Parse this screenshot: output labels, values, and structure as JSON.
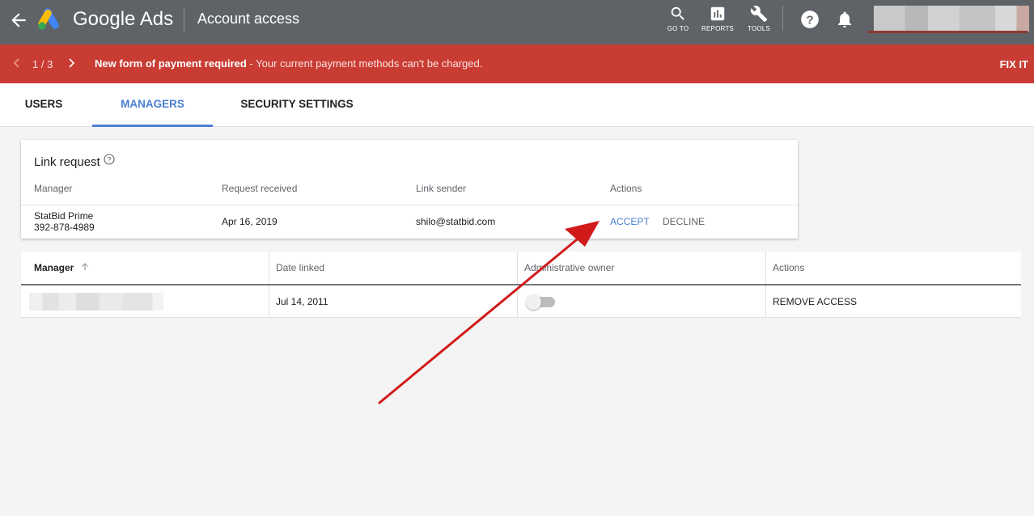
{
  "topbar": {
    "brand": "Google Ads",
    "page_title": "Account access",
    "tools": [
      {
        "label": "GO TO",
        "icon": "search-icon"
      },
      {
        "label": "REPORTS",
        "icon": "reports-icon"
      },
      {
        "label": "TOOLS",
        "icon": "wrench-icon"
      }
    ],
    "icons": [
      "back-arrow-icon",
      "google-ads-logo",
      "help-icon",
      "notifications-bell-icon"
    ]
  },
  "alert": {
    "counter": "1 / 3",
    "title": "New form of payment required",
    "message": " - Your current payment methods can't be charged.",
    "action": "FIX IT",
    "color": "#c93c33"
  },
  "tabs": [
    {
      "label": "USERS",
      "active": false
    },
    {
      "label": "MANAGERS",
      "active": true
    },
    {
      "label": "SECURITY SETTINGS",
      "active": false
    }
  ],
  "link_request": {
    "title": "Link request",
    "columns": [
      "Manager",
      "Request received",
      "Link sender",
      "Actions"
    ],
    "row": {
      "manager_name": "StatBid Prime",
      "manager_id": "392-878-4989",
      "received": "Apr 16, 2019",
      "sender": "shilo@statbid.com",
      "accept": "ACCEPT",
      "decline": "DECLINE"
    }
  },
  "managers_table": {
    "columns": [
      "Manager",
      "Date linked",
      "Administrative owner",
      "Actions"
    ],
    "rows": [
      {
        "manager": "",
        "date_linked": "Jul 14, 2011",
        "admin_owner": false,
        "action": "REMOVE ACCESS"
      }
    ]
  },
  "colors": {
    "topbar": "#5f6368",
    "accent": "#4a7fd4",
    "annotation_arrow": "#d11a1a"
  }
}
